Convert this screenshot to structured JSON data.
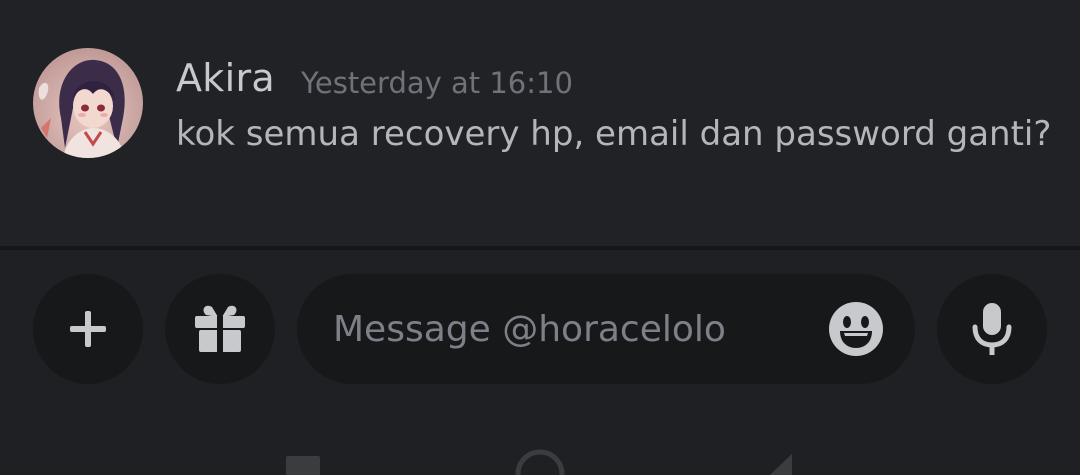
{
  "message": {
    "username": "Akira",
    "timestamp": "Yesterday at 16:10",
    "text": "kok semua recovery hp, email dan password ganti?"
  },
  "composer": {
    "placeholder": "Message @horacelolo",
    "value": ""
  },
  "icons": {
    "add": "plus-icon",
    "gift": "gift-icon",
    "emoji": "smile-emoji-icon",
    "mic": "microphone-icon",
    "nav_recents": "square-icon",
    "nav_home": "circle-icon",
    "nav_back": "triangle-back-icon"
  },
  "colors": {
    "background": "#1f2023",
    "bubble": "#17181a",
    "username": "#c8c9cc",
    "timestamp": "#6f727a",
    "text": "#b4b6ba",
    "icon": "#c8c9cc"
  }
}
